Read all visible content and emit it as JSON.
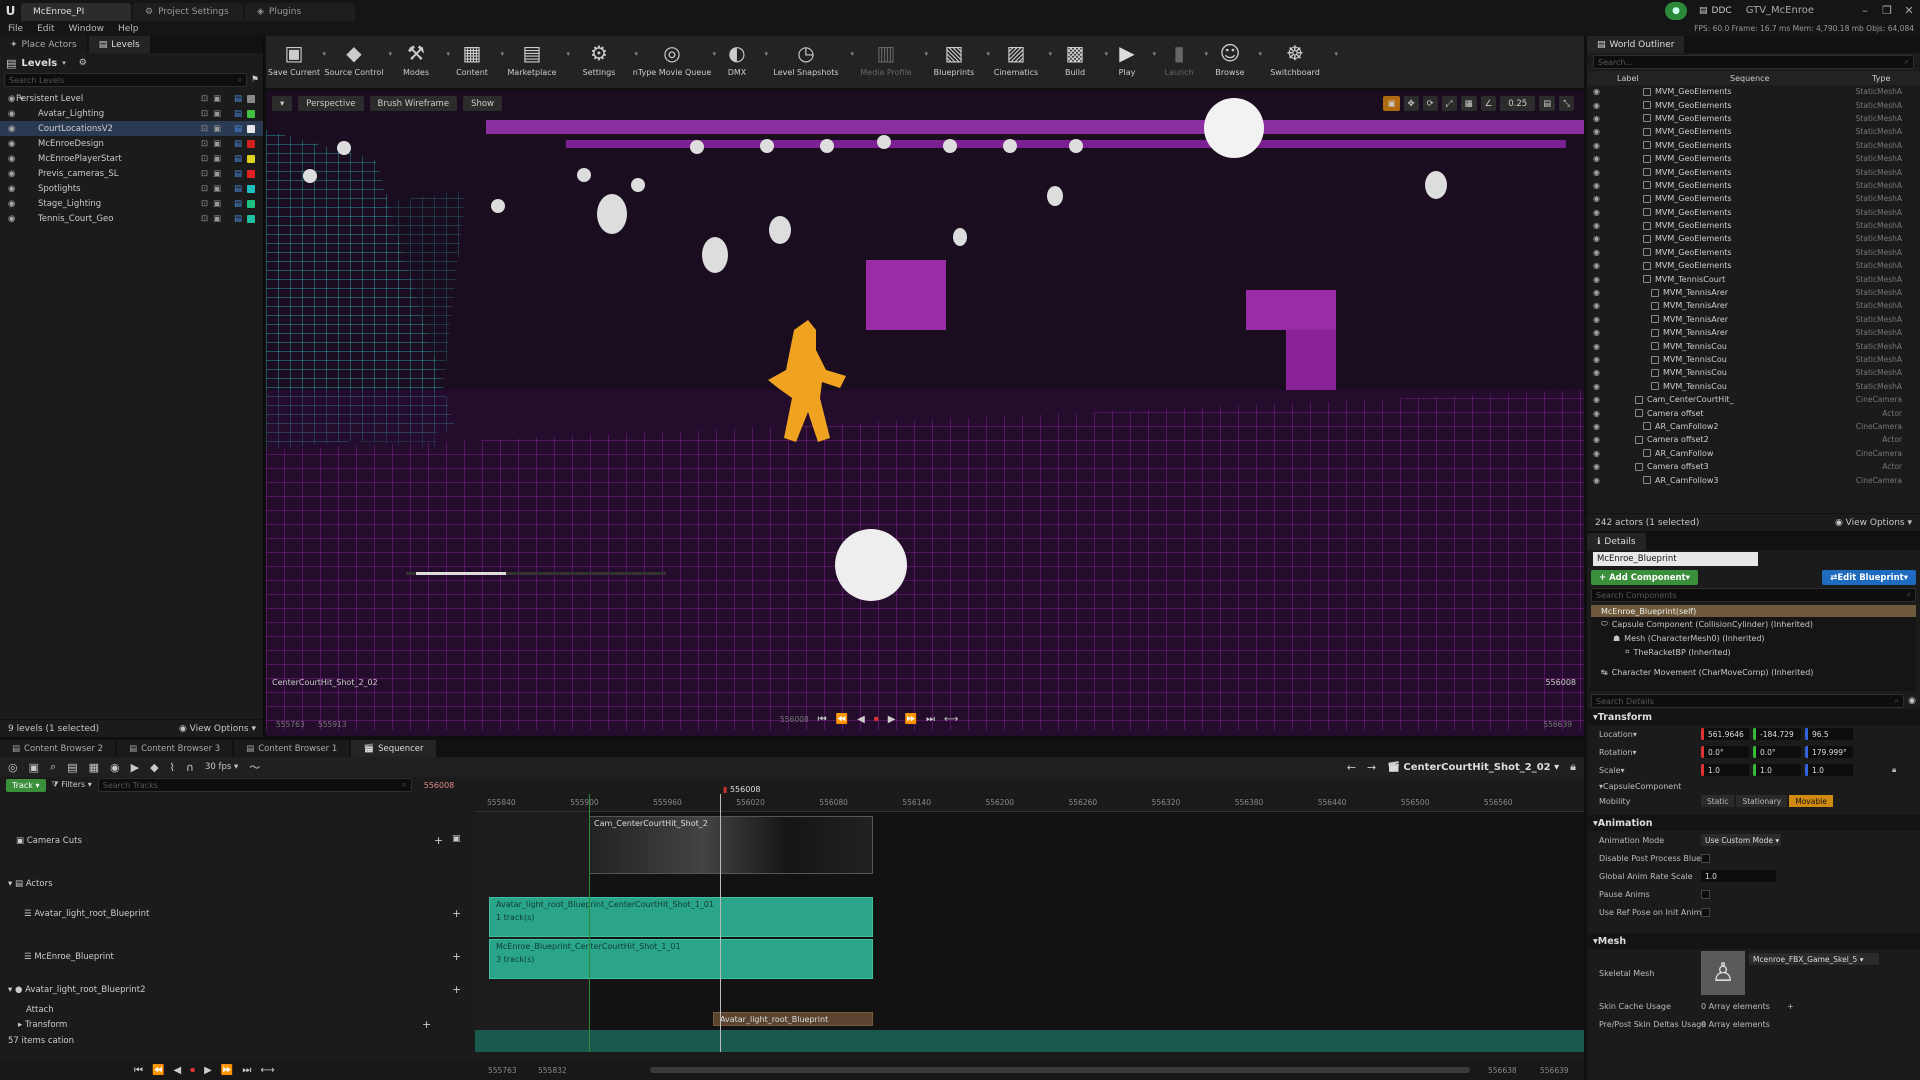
{
  "titlebar": {
    "tabs": [
      "McEnroe_PI",
      "Project Settings",
      "Plugins"
    ],
    "project_badge": "DDC",
    "project_name": "GTV_McEnroe",
    "stats": "FPS: 60.0   Frame: 16.7 ms   Mem: 4,790.18 mb   Objs: 64,084"
  },
  "menu": [
    "File",
    "Edit",
    "Window",
    "Help"
  ],
  "left_panel": {
    "tabs": [
      "Place Actors",
      "Levels"
    ],
    "title": "Levels",
    "search_placeholder": "Search Levels",
    "levels": [
      {
        "name": "Persistent Level",
        "color": "#888888"
      },
      {
        "name": "Avatar_Lighting",
        "color": "#40c040"
      },
      {
        "name": "CourtLocationsV2",
        "color": "#e8e8e8"
      },
      {
        "name": "McEnroeDesign",
        "color": "#d02020"
      },
      {
        "name": "McEnroePlayerStart",
        "color": "#e0d020"
      },
      {
        "name": "Previs_cameras_SL",
        "color": "#e02020"
      },
      {
        "name": "Spotlights",
        "color": "#20c0c0"
      },
      {
        "name": "Stage_Lighting",
        "color": "#20c080"
      },
      {
        "name": "Tennis_Court_Geo",
        "color": "#20c0a0"
      }
    ],
    "footer": "9 levels (1 selected)",
    "view_options": "View Options"
  },
  "toolbar": [
    {
      "label": "Save Current",
      "icon": "save-icon",
      "glyph": "▣"
    },
    {
      "label": "Source Control",
      "icon": "source-control-icon",
      "glyph": "◆"
    },
    {
      "label": "Modes",
      "icon": "modes-icon",
      "glyph": "⚒"
    },
    {
      "label": "Content",
      "icon": "content-icon",
      "glyph": "▦"
    },
    {
      "label": "Marketplace",
      "icon": "marketplace-icon",
      "glyph": "▤"
    },
    {
      "label": "Settings",
      "icon": "settings-icon",
      "glyph": "⚙"
    },
    {
      "label": "nType Movie Queue",
      "icon": "movie-queue-icon",
      "glyph": "◎"
    },
    {
      "label": "DMX",
      "icon": "dmx-icon",
      "glyph": "◐"
    },
    {
      "label": "Level Snapshots",
      "icon": "snapshot-icon",
      "glyph": "◷"
    },
    {
      "label": "Media Profile",
      "icon": "media-profile-icon",
      "glyph": "▥",
      "disabled": true
    },
    {
      "label": "Blueprints",
      "icon": "blueprints-icon",
      "glyph": "▧"
    },
    {
      "label": "Cinematics",
      "icon": "cinematics-icon",
      "glyph": "▨"
    },
    {
      "label": "Build",
      "icon": "build-icon",
      "glyph": "▩"
    },
    {
      "label": "Play",
      "icon": "play-icon",
      "glyph": "▶"
    },
    {
      "label": "Launch",
      "icon": "launch-icon",
      "glyph": "▮",
      "disabled": true
    },
    {
      "label": "Browse",
      "icon": "browse-icon",
      "glyph": "☺"
    },
    {
      "label": "Switchboard",
      "icon": "switchboard-icon",
      "glyph": "☸"
    }
  ],
  "viewport": {
    "perspective": "Perspective",
    "view_mode": "Brush Wireframe",
    "show": "Show",
    "snap_value": "0.25",
    "shot_label": "CenterCourtHit_Shot_2_02",
    "frame_right": "556008",
    "range_start": "555763",
    "range_start2": "555913",
    "range_end": "556639",
    "current_frame": "556008"
  },
  "outliner": {
    "title": "World Outliner",
    "search_placeholder": "Search...",
    "columns": [
      "Label",
      "Sequence",
      "Type"
    ],
    "rows": [
      {
        "label": "MVM_GeoElements",
        "type": "StaticMeshA",
        "indent": 3
      },
      {
        "label": "MVM_GeoElements",
        "type": "StaticMeshA",
        "indent": 3
      },
      {
        "label": "MVM_GeoElements",
        "type": "StaticMeshA",
        "indent": 3
      },
      {
        "label": "MVM_GeoElements",
        "type": "StaticMeshA",
        "indent": 3
      },
      {
        "label": "MVM_GeoElements",
        "type": "StaticMeshA",
        "indent": 3
      },
      {
        "label": "MVM_GeoElements",
        "type": "StaticMeshA",
        "indent": 3
      },
      {
        "label": "MVM_GeoElements",
        "type": "StaticMeshA",
        "indent": 3
      },
      {
        "label": "MVM_GeoElements",
        "type": "StaticMeshA",
        "indent": 3
      },
      {
        "label": "MVM_GeoElements",
        "type": "StaticMeshA",
        "indent": 3
      },
      {
        "label": "MVM_GeoElements",
        "type": "StaticMeshA",
        "indent": 3
      },
      {
        "label": "MVM_GeoElements",
        "type": "StaticMeshA",
        "indent": 3
      },
      {
        "label": "MVM_GeoElements",
        "type": "StaticMeshA",
        "indent": 3
      },
      {
        "label": "MVM_GeoElements",
        "type": "StaticMeshA",
        "indent": 3
      },
      {
        "label": "MVM_GeoElements",
        "type": "StaticMeshA",
        "indent": 3
      },
      {
        "label": "MVM_TennisCourt",
        "type": "StaticMeshA",
        "indent": 3
      },
      {
        "label": "MVM_TennisArer",
        "type": "StaticMeshA",
        "indent": 4
      },
      {
        "label": "MVM_TennisArer",
        "type": "StaticMeshA",
        "indent": 4
      },
      {
        "label": "MVM_TennisArer",
        "type": "StaticMeshA",
        "indent": 4
      },
      {
        "label": "MVM_TennisArer",
        "type": "StaticMeshA",
        "indent": 4
      },
      {
        "label": "MVM_TennisCou",
        "type": "StaticMeshA",
        "indent": 4
      },
      {
        "label": "MVM_TennisCou",
        "type": "StaticMeshA",
        "indent": 4
      },
      {
        "label": "MVM_TennisCou",
        "type": "StaticMeshA",
        "indent": 4
      },
      {
        "label": "MVM_TennisCou",
        "type": "StaticMeshA",
        "indent": 4
      },
      {
        "label": "Cam_CenterCourtHit_",
        "type": "CineCamera",
        "indent": 2
      },
      {
        "label": "Camera offset",
        "type": "Actor",
        "indent": 2
      },
      {
        "label": "AR_CamFollow2",
        "type": "CineCamera",
        "indent": 3
      },
      {
        "label": "Camera offset2",
        "type": "Actor",
        "indent": 2
      },
      {
        "label": "AR_CamFollow",
        "type": "CineCamera",
        "indent": 3
      },
      {
        "label": "Camera offset3",
        "type": "Actor",
        "indent": 2
      },
      {
        "label": "AR_CamFollow3",
        "type": "CineCamera",
        "indent": 3
      }
    ],
    "footer": "242 actors (1 selected)",
    "view_options": "View Options"
  },
  "details": {
    "title": "Details",
    "object_name": "McEnroe_Blueprint",
    "add_component": "+ Add Component",
    "edit_blueprint": "Edit Blueprint",
    "search_components": "Search Components",
    "self_row": "McEnroe_Blueprint(self)",
    "components": [
      "Capsule Component (CollisionCylinder) (Inherited)",
      "Mesh (CharacterMesh0) (Inherited)",
      "TheRacketBP (Inherited)",
      "Character Movement (CharMoveComp) (Inherited)"
    ],
    "search_details": "Search Details",
    "transform": {
      "title": "Transform",
      "location_label": "Location",
      "rotation_label": "Rotation",
      "scale_label": "Scale",
      "location": [
        "561.9646",
        "-184.729",
        "96.5"
      ],
      "rotation": [
        "0.0°",
        "0.0°",
        "179.999°"
      ],
      "scale": [
        "1.0",
        "1.0",
        "1.0"
      ],
      "capsule_label": "CapsuleComponent",
      "mobility_label": "Mobility",
      "mobility": [
        "Static",
        "Stationary",
        "Movable"
      ]
    },
    "animation": {
      "title": "Animation",
      "mode_label": "Animation Mode",
      "mode_value": "Use Custom Mode",
      "disable_pp": "Disable Post Process Bluep",
      "rate_label": "Global Anim Rate Scale",
      "rate_value": "1.0",
      "pause": "Pause Anims",
      "ref_pose": "Use Ref Pose on Init Anim"
    },
    "mesh": {
      "title": "Mesh",
      "skeletal_label": "Skeletal Mesh",
      "skeletal_value": "Mcenroe_FBX_Game_Skel_5",
      "skin_cache": "Skin Cache Usage",
      "skin_cache_value": "0 Array elements",
      "pre_post": "Pre/Post Skin Deltas Usage",
      "pre_post_value": "0 Array elements"
    }
  },
  "bottom": {
    "tabs": [
      "Content Browser 2",
      "Content Browser 3",
      "Content Browser 1",
      "Sequencer"
    ],
    "fps": "30 fps",
    "track_btn": "Track",
    "filters": "Filters",
    "search_tracks": "Search Tracks",
    "frame_field": "556008",
    "sequence_name": "CenterCourtHit_Shot_2_02",
    "ruler_ticks": [
      "555840",
      "555900",
      "555960",
      "556020",
      "556080",
      "556140",
      "556200",
      "556260",
      "556320",
      "556380",
      "556440",
      "556500",
      "556560"
    ],
    "playhead": "556008",
    "tracks": {
      "camera_cuts": "Camera Cuts",
      "actors": "Actors",
      "avatar_bp": "Avatar_light_root_Blueprint",
      "mcenroe_bp": "McEnroe_Blueprint",
      "avatar_bp2": "Avatar_light_root_Blueprint2",
      "attach": "Attach",
      "transform": "Transform",
      "items": "57 items",
      "location": "cation"
    },
    "clips": {
      "camera": "Cam_CenterCourtHit_Shot_2",
      "avatar": "Avatar_light_root_Blueprint_CenterCourtHit_Shot_1_01",
      "avatar_sub": "1 track(s)",
      "mcenroe": "McEnroe_Blueprint_CenterCourtHit_Shot_1_01",
      "mcenroe_sub": "3 track(s)",
      "attach": "Avatar_light_root_Blueprint"
    },
    "footer": {
      "start": "555763",
      "start2": "555832",
      "end": "556638",
      "end2": "556639"
    }
  }
}
